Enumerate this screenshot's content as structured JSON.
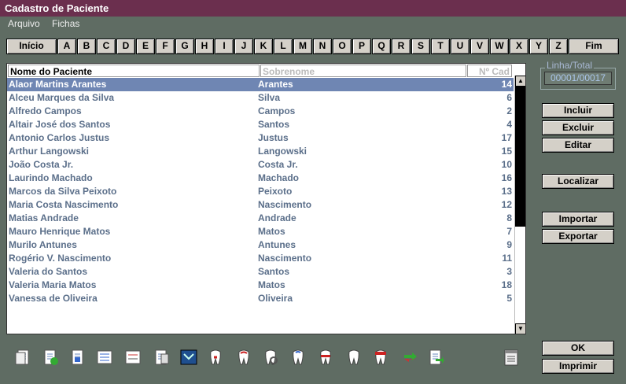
{
  "window": {
    "title": "Cadastro de Paciente"
  },
  "menu": [
    {
      "label": "Arquivo"
    },
    {
      "label": "Fichas"
    }
  ],
  "alphabet": {
    "start": "Início",
    "letters": [
      "A",
      "B",
      "C",
      "D",
      "E",
      "F",
      "G",
      "H",
      "I",
      "J",
      "K",
      "L",
      "M",
      "N",
      "O",
      "P",
      "Q",
      "R",
      "S",
      "T",
      "U",
      "V",
      "W",
      "X",
      "Y",
      "Z"
    ],
    "end": "Fim"
  },
  "table": {
    "headers": {
      "name": "Nome do Paciente",
      "surname": "Sobrenome",
      "id": "Nº Cad"
    },
    "rows": [
      {
        "name": "Alaor Martins Arantes",
        "surname": "Arantes",
        "id": "14",
        "selected": true
      },
      {
        "name": "Alceu Marques da Silva",
        "surname": "Silva",
        "id": "6"
      },
      {
        "name": "Alfredo Campos",
        "surname": "Campos",
        "id": "2"
      },
      {
        "name": "Altair José dos Santos",
        "surname": "Santos",
        "id": "4"
      },
      {
        "name": "Antonio Carlos Justus",
        "surname": "Justus",
        "id": "17"
      },
      {
        "name": "Arthur Langowski",
        "surname": "Langowski",
        "id": "15"
      },
      {
        "name": "João Costa Jr.",
        "surname": "Costa Jr.",
        "id": "10"
      },
      {
        "name": "Laurindo Machado",
        "surname": "Machado",
        "id": "16"
      },
      {
        "name": "Marcos da Silva Peixoto",
        "surname": "Peixoto",
        "id": "13"
      },
      {
        "name": "Maria Costa Nascimento",
        "surname": "Nascimento",
        "id": "12"
      },
      {
        "name": "Matias Andrade",
        "surname": "Andrade",
        "id": "8"
      },
      {
        "name": "Mauro Henrique Matos",
        "surname": "Matos",
        "id": "7"
      },
      {
        "name": "Murilo Antunes",
        "surname": "Antunes",
        "id": "9"
      },
      {
        "name": "Rogério V. Nascimento",
        "surname": "Nascimento",
        "id": "11"
      },
      {
        "name": "Valeria do Santos",
        "surname": "Santos",
        "id": "3"
      },
      {
        "name": "Valeria Maria Matos",
        "surname": "Matos",
        "id": "18"
      },
      {
        "name": "Vanessa de Oliveira",
        "surname": "Oliveira",
        "id": "5"
      }
    ]
  },
  "counter": {
    "label": "Linha/Total",
    "value": "00001/00017"
  },
  "buttons": {
    "incluir": "Incluir",
    "excluir": "Excluir",
    "editar": "Editar",
    "localizar": "Localizar",
    "importar": "Importar",
    "exportar": "Exportar",
    "ok": "OK",
    "imprimir": "Imprimir"
  },
  "toolbar_icons": [
    "copy-document-icon",
    "patient-check-icon",
    "document-icon",
    "list-icon",
    "form-icon",
    "documents-icon",
    "dental-chart-icon",
    "tooth-red-icon",
    "tooth-outline-icon",
    "tooth-search-icon",
    "tooth-blue-icon",
    "tooth-cross-icon",
    "tooth-white-icon",
    "tooth-crown-icon",
    "exchange-icon",
    "export-document-icon"
  ]
}
